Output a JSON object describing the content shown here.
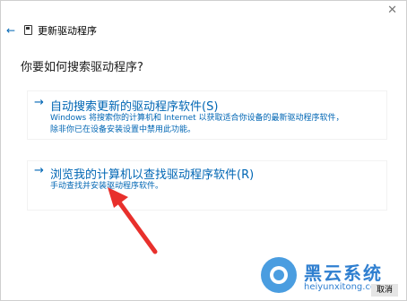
{
  "window": {
    "title": "更新驱动程序",
    "close_glyph": "✕",
    "back_glyph": "←"
  },
  "heading": "你要如何搜索驱动程序?",
  "options": [
    {
      "arrow": "→",
      "title": "自动搜索更新的驱动程序软件(S)",
      "desc_line1": "Windows 将搜索你的计算机和 Internet 以获取适合你设备的最新驱动程序软件，",
      "desc_line2": "除非你已在设备安装设置中禁用此功能。"
    },
    {
      "arrow": "→",
      "title": "浏览我的计算机以查找驱动程序软件(R)",
      "desc_line1": "手动查找并安装驱动程序软件。"
    }
  ],
  "footer": {
    "cancel_label": "取消"
  },
  "watermark": {
    "name": "黑云系统",
    "site": "heiyunxitong.com"
  },
  "colors": {
    "link": "#0066b4",
    "annotation_arrow": "#e8302c",
    "watermark": "#2f7fd0"
  },
  "icons": [
    "close-icon",
    "back-arrow-icon",
    "device-icon",
    "arrow-right-icon",
    "heiyun-logo-icon"
  ]
}
